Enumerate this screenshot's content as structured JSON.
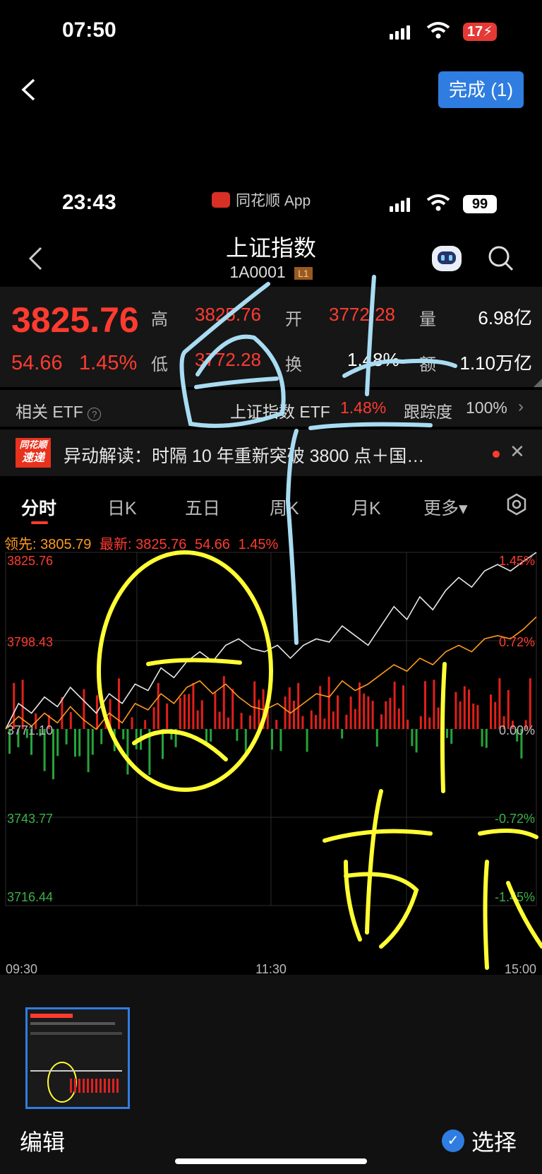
{
  "outer": {
    "status": {
      "time": "07:50",
      "battery": "17"
    },
    "done_button": "完成 (1)"
  },
  "inner": {
    "status": {
      "time": "23:43",
      "app_name": "同花顺 App",
      "battery": "99"
    },
    "header": {
      "title": "上证指数",
      "code": "1A0001",
      "level_badge": "L1"
    },
    "quote": {
      "price": "3825.76",
      "change": "54.66",
      "change_pct": "1.45%",
      "high_label": "高",
      "high": "3825.76",
      "open_label": "开",
      "open": "3772.28",
      "volume_label": "量",
      "volume": "6.98亿",
      "low_label": "低",
      "low": "3772.28",
      "turnover_label": "换",
      "turnover": "1.48%",
      "amount_label": "额",
      "amount": "1.10万亿"
    },
    "etf": {
      "label": "相关 ETF",
      "name": "上证指数 ETF",
      "pct": "1.48%",
      "track_label": "跟踪度",
      "track_value": "100%"
    },
    "news": {
      "badge_top": "同花顺",
      "badge_bottom": "速递",
      "text": "异动解读：时隔 10 年重新突破 3800 点＋国…"
    },
    "tabs": [
      "分时",
      "日K",
      "五日",
      "周K",
      "月K",
      "更多▾"
    ],
    "chart_info": {
      "lead_label": "领先:",
      "lead": "3805.79",
      "latest_label": "最新:",
      "latest": "3825.76",
      "chg": "54.66",
      "pct": "1.45%"
    }
  },
  "chart_data": {
    "type": "line",
    "y_labels_left": [
      "3825.76",
      "3798.43",
      "3771.10",
      "3743.77",
      "3716.44"
    ],
    "y_labels_right": [
      "1.45%",
      "0.72%",
      "0.00%",
      "-0.72%",
      "-1.45%"
    ],
    "x_labels": [
      "09:30",
      "11:30",
      "15:00"
    ],
    "ylim": [
      3716.44,
      3825.76
    ],
    "series": [
      {
        "name": "最新",
        "color": "#e8e8e8",
        "values": [
          3771.1,
          3779,
          3776,
          3781,
          3778,
          3784,
          3780,
          3776,
          3782,
          3779,
          3785,
          3783,
          3790,
          3787,
          3792,
          3795,
          3792,
          3797,
          3799,
          3796,
          3795,
          3797,
          3793,
          3797,
          3799,
          3798,
          3803,
          3800,
          3797,
          3803,
          3809,
          3805,
          3812,
          3808,
          3814,
          3818,
          3815,
          3820,
          3822,
          3820,
          3823,
          3825.76
        ]
      },
      {
        "name": "领先",
        "color": "#ff9a1f",
        "values": [
          3771.1,
          3775,
          3772,
          3776,
          3773,
          3778,
          3774,
          3771,
          3776,
          3773,
          3779,
          3777,
          3782,
          3779,
          3784,
          3786,
          3782,
          3785,
          3781,
          3778,
          3777,
          3779,
          3776,
          3779,
          3782,
          3781,
          3786,
          3783,
          3785,
          3788,
          3791,
          3789,
          3793,
          3791,
          3795,
          3797,
          3795,
          3799,
          3800,
          3799,
          3802,
          3805.79
        ]
      }
    ]
  },
  "annotations": {
    "note1": "白上",
    "note2": "黄下"
  },
  "bottom": {
    "edit": "编辑",
    "select": "选择"
  }
}
